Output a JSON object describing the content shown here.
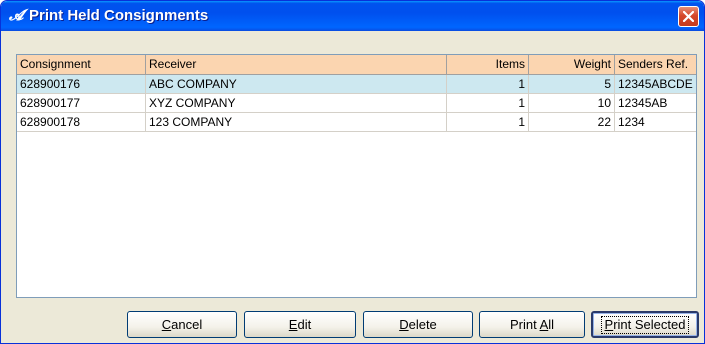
{
  "window": {
    "title": "Print Held Consignments",
    "title_icon": "pen-logo-icon",
    "close_icon": "close-icon"
  },
  "table": {
    "columns": [
      "Consignment",
      "Receiver",
      "Items",
      "Weight",
      "Senders Ref."
    ],
    "rows": [
      {
        "consignment": "628900176",
        "receiver": "ABC COMPANY",
        "items": "1",
        "weight": "5",
        "senders_ref": "12345ABCDE",
        "selected": true
      },
      {
        "consignment": "628900177",
        "receiver": "XYZ COMPANY",
        "items": "1",
        "weight": "10",
        "senders_ref": "12345AB",
        "selected": false
      },
      {
        "consignment": "628900178",
        "receiver": "123 COMPANY",
        "items": "1",
        "weight": "22",
        "senders_ref": "1234",
        "selected": false
      }
    ]
  },
  "buttons": {
    "cancel": {
      "mnemonic": "C",
      "rest": "ancel"
    },
    "edit": {
      "mnemonic": "E",
      "rest": "dit"
    },
    "delete": {
      "mnemonic": "D",
      "rest": "elete"
    },
    "print_all": {
      "prefix": "Print ",
      "mnemonic": "A",
      "rest": "ll"
    },
    "print_selected": {
      "mnemonic": "P",
      "rest": "rint Selected"
    }
  },
  "colors": {
    "titlebar": "#0053ee",
    "header_bg": "#fbd5b0",
    "selected_row": "#cde8f0",
    "close_button": "#d6482a"
  }
}
